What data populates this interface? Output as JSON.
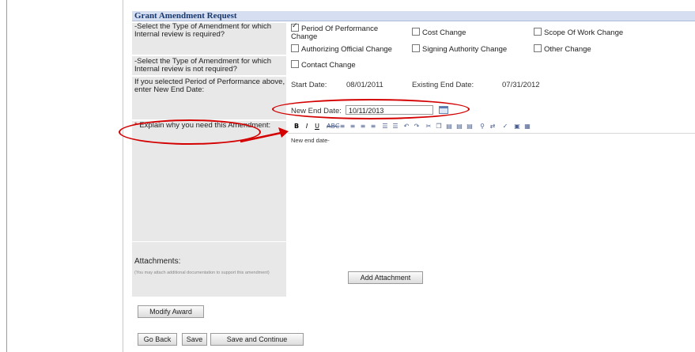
{
  "form": {
    "title": "Grant Amendment Request",
    "q_review_required": "-Select the Type of Amendment for which Internal review is required?",
    "q_review_not_required": "-Select the Type of Amendment for which Internal review is not required?",
    "q_new_end_date": "If you selected Period of Performance above, enter New End Date:",
    "options_required": [
      {
        "label": "Period Of Performance",
        "label2": "Change",
        "checked": true
      },
      {
        "label": "Cost Change",
        "checked": false
      },
      {
        "label": "Scope Of Work Change",
        "checked": false
      },
      {
        "label": "Authorizing Official Change",
        "checked": false
      },
      {
        "label": "Signing Authority Change",
        "checked": false
      },
      {
        "label": "Other Change",
        "checked": false
      }
    ],
    "options_not_required": [
      {
        "label": "Contact Change",
        "checked": false
      }
    ],
    "start_date_label": "Start Date:",
    "start_date": "08/01/2011",
    "existing_end_label": "Existing End Date:",
    "existing_end_date": "07/31/2012",
    "new_end_label": "New End Date:",
    "new_end_value": "10/11/2013",
    "explain_required_marker": "*",
    "explain_label": "Explain why you need this Amendment:",
    "explain_text": "New end date-",
    "attachments_label": "Attachments:",
    "attachments_hint": "(You may attach additional documentation to support this amendment)"
  },
  "buttons": {
    "add_attachment": "Add Attachment",
    "modify_award": "Modify Award",
    "go_back": "Go Back",
    "save": "Save",
    "save_continue": "Save and Continue"
  },
  "toolbar_icons": [
    "bold-icon",
    "italic-icon",
    "underline-icon",
    "strikethrough-icon",
    "align-left-icon",
    "align-center-icon",
    "align-right-icon",
    "align-justify-icon",
    "bullet-list-icon",
    "numbered-list-icon",
    "undo-icon",
    "redo-icon",
    "cut-icon",
    "copy-icon",
    "paste-icon",
    "paste-text-icon",
    "paste-word-icon",
    "find-icon",
    "replace-icon",
    "spellcheck-icon",
    "image-icon",
    "table-icon"
  ],
  "colors": {
    "header_bg": "#d6dff2",
    "label_bg": "#e8e8e8",
    "annotation": "#d40000",
    "title": "#18386e"
  }
}
